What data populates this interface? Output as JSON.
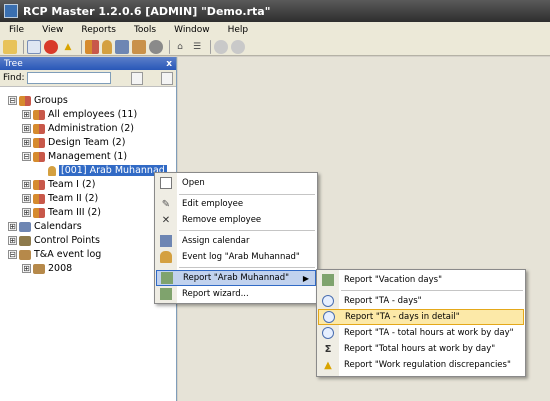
{
  "window": {
    "title": "RCP Master 1.2.0.6  [ADMIN] \"Demo.rta\""
  },
  "menubar": [
    "File",
    "View",
    "Reports",
    "Tools",
    "Window",
    "Help"
  ],
  "toolbar": {
    "icons": [
      "open-folder-icon",
      "document-icon",
      "stop-icon",
      "warning-icon",
      "users-icon",
      "user-icon",
      "calendar-icon",
      "group-icon",
      "gear-icon",
      "home-icon",
      "tree-icon",
      "back-icon",
      "forward-icon"
    ]
  },
  "panel": {
    "title": "Tree",
    "close": "x",
    "find_label": "Find:"
  },
  "tree": {
    "nodes": [
      {
        "label": "Groups",
        "expander": "⊟",
        "level": 0
      },
      {
        "label": "All employees (11)",
        "expander": "⊞",
        "level": 1
      },
      {
        "label": "Administration (2)",
        "expander": "⊞",
        "level": 1
      },
      {
        "label": "Design Team (2)",
        "expander": "⊞",
        "level": 1
      },
      {
        "label": "Management (1)",
        "expander": "⊟",
        "level": 1
      },
      {
        "label": "[001]  Arab Muhannad",
        "expander": "",
        "level": 2
      },
      {
        "label": "Team I (2)",
        "expander": "⊞",
        "level": 1
      },
      {
        "label": "Team II (2)",
        "expander": "⊞",
        "level": 1
      },
      {
        "label": "Team III (2)",
        "expander": "⊞",
        "level": 1
      },
      {
        "label": "Calendars",
        "expander": "⊞",
        "level": 0
      },
      {
        "label": "Control Points",
        "expander": "⊞",
        "level": 0
      },
      {
        "label": "T&A event log",
        "expander": "⊟",
        "level": 0
      },
      {
        "label": "2008",
        "expander": "⊞",
        "level": 1
      }
    ]
  },
  "context_menu": {
    "items": [
      {
        "label": "Open",
        "icon": "open-icon"
      },
      {
        "label": "Edit employee",
        "icon": "edit-icon"
      },
      {
        "label": "Remove employee",
        "icon": "remove-icon"
      },
      {
        "label": "Assign calendar",
        "icon": "calendar-icon"
      },
      {
        "label": "Event log \"Arab Muhannad\"",
        "icon": "event-log-icon"
      },
      {
        "label": "Report \"Arab Muhannad\"",
        "icon": "report-icon",
        "submenu_arrow": "▶"
      },
      {
        "label": "Report wizard...",
        "icon": "wizard-icon"
      }
    ]
  },
  "submenu": {
    "items": [
      {
        "label": "Report \"Vacation days\"",
        "icon": "report-icon"
      },
      {
        "label": "Report \"TA - days\"",
        "icon": "clock-icon"
      },
      {
        "label": "Report \"TA - days in detail\"",
        "icon": "clock-icon"
      },
      {
        "label": "Report \"TA - total hours at work by day\"",
        "icon": "clock-icon"
      },
      {
        "label": "Report \"Total hours at work by day\"",
        "icon": "sigma-icon"
      },
      {
        "label": "Report \"Work regulation discrepancies\"",
        "icon": "warning-icon"
      }
    ]
  },
  "colors": {
    "title_bar": "#3e3e3e",
    "panel_header": "#2957b8",
    "selection": "#316ac5",
    "hover_highlight": "#fce9a8"
  }
}
